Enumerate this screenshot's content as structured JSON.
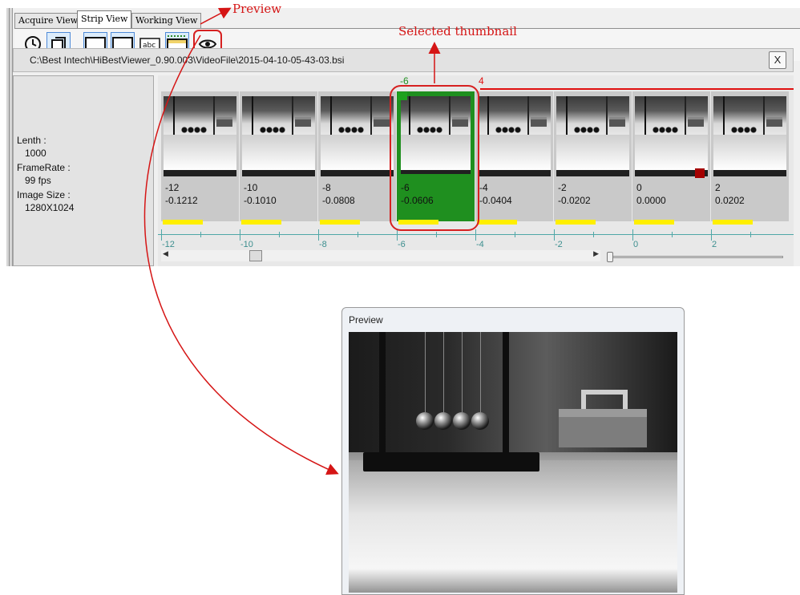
{
  "tabs": [
    {
      "label": "Acquire View"
    },
    {
      "label": "Strip View"
    },
    {
      "label": "Working View"
    }
  ],
  "toolbar": {
    "icons": [
      "clock-icon",
      "copy-frames-icon",
      "strip-icon",
      "strip-icon-2",
      "abc-label-icon",
      "ruler-strip-icon",
      "eye-icon"
    ]
  },
  "file_path": "C:\\Best Intech\\HiBestViewer_0.90.003\\VideoFile\\2015-04-10-05-43-03.bsi",
  "close_label": "X",
  "info": {
    "length_label": "Lenth :",
    "length_value": "1000",
    "framerate_label": "FrameRate :",
    "framerate_value": "99 fps",
    "image_size_label": "Image Size :",
    "image_size_value": "1280X1024"
  },
  "strip": {
    "top_selected_label": "-6",
    "top_marker_label": "4",
    "thumbnails": [
      {
        "frame": "-12",
        "time": "-0.1212",
        "selected": false,
        "marker": false
      },
      {
        "frame": "-10",
        "time": "-0.1010",
        "selected": false,
        "marker": false
      },
      {
        "frame": "-8",
        "time": "-0.0808",
        "selected": false,
        "marker": false
      },
      {
        "frame": "-6",
        "time": "-0.0606",
        "selected": true,
        "marker": false
      },
      {
        "frame": "-4",
        "time": "-0.0404",
        "selected": false,
        "marker": false
      },
      {
        "frame": "-2",
        "time": "-0.0202",
        "selected": false,
        "marker": false
      },
      {
        "frame": "0",
        "time": "0.0000",
        "selected": false,
        "marker": true
      },
      {
        "frame": "2",
        "time": "0.0202",
        "selected": false,
        "marker": false
      }
    ],
    "ruler_labels": [
      "-12",
      "-10",
      "-8",
      "-6",
      "-4",
      "-2",
      "0",
      "2"
    ]
  },
  "annotations": {
    "preview": "Preview",
    "selected_thumbnail": "Selected thumbnail"
  },
  "preview_window": {
    "title": "Preview"
  },
  "colors": {
    "annotation_red": "#d51515",
    "selected_green": "#1f8f1f",
    "yellow_mark": "#ffef00",
    "ruler_teal": "#4fa7a7"
  }
}
